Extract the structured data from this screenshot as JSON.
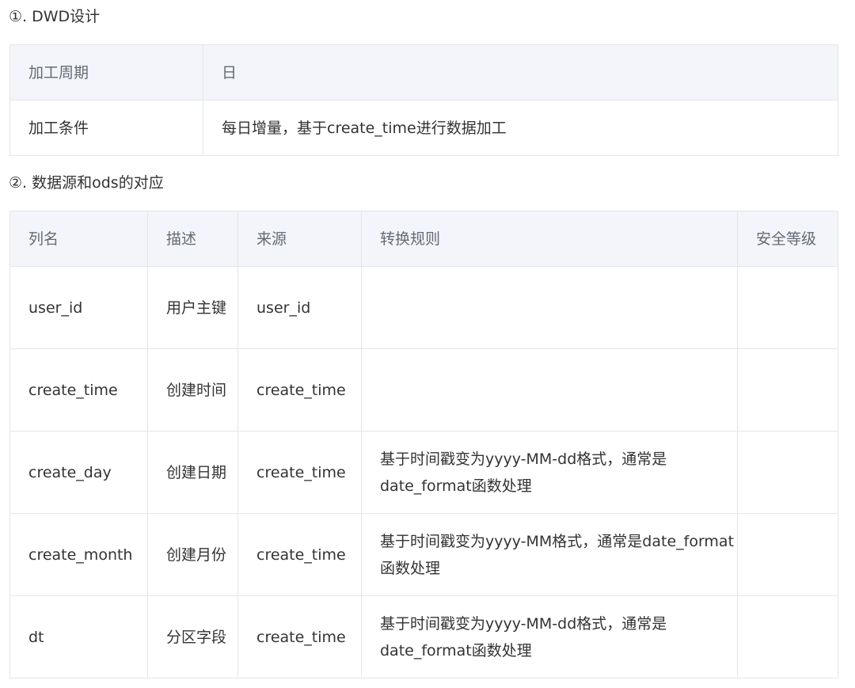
{
  "section1": {
    "heading": "①. DWD设计",
    "rows": [
      {
        "label": "加工周期",
        "value": "日"
      },
      {
        "label": "加工条件",
        "value": "每日增量，基于create_time进行数据加工"
      }
    ]
  },
  "section2": {
    "heading": "②. 数据源和ods的对应",
    "columns": [
      "列名",
      "描述",
      "来源",
      "转换规则",
      "安全等级"
    ],
    "rows": [
      {
        "name": "user_id",
        "desc": "用户主键",
        "source": "user_id",
        "rule": "",
        "level": ""
      },
      {
        "name": "create_time",
        "desc": "创建时间",
        "source": "create_time",
        "rule": "",
        "level": ""
      },
      {
        "name": "create_day",
        "desc": "创建日期",
        "source": "create_time",
        "rule": "基于时间戳变为yyyy-MM-dd格式，通常是date_format函数处理",
        "level": ""
      },
      {
        "name": "create_month",
        "desc": "创建月份",
        "source": "create_time",
        "rule": "基于时间戳变为yyyy-MM格式，通常是date_format函数处理",
        "level": ""
      },
      {
        "name": "dt",
        "desc": "分区字段",
        "source": "create_time",
        "rule": "基于时间戳变为yyyy-MM-dd格式，通常是date_format函数处理",
        "level": ""
      }
    ]
  }
}
